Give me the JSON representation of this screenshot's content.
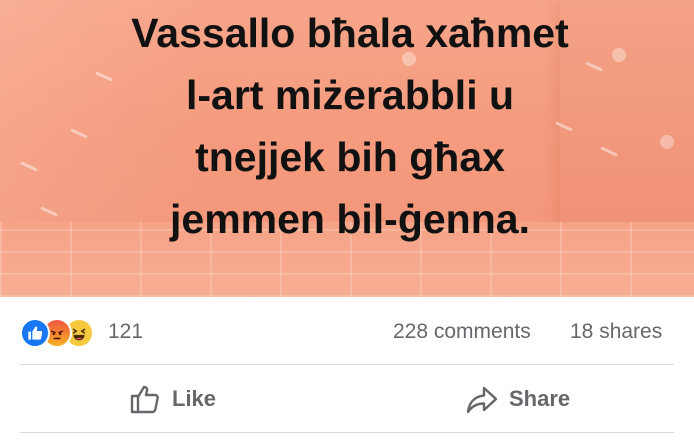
{
  "post": {
    "image_text_lines": [
      "Vassallo bħala xaħmet",
      "l-art miżerabbli u",
      "tnejjek bih għax",
      "jemmen bil-ġenna."
    ],
    "background_color": "#f59b7e"
  },
  "engagement": {
    "reaction_icons": [
      "like-icon",
      "angry-icon",
      "haha-icon"
    ],
    "reaction_count": "121",
    "comments": "228 comments",
    "shares": "18 shares"
  },
  "actions": {
    "like_label": "Like",
    "share_label": "Share"
  },
  "colors": {
    "like_blue": "#1877f2",
    "muted_text": "#65676b"
  }
}
